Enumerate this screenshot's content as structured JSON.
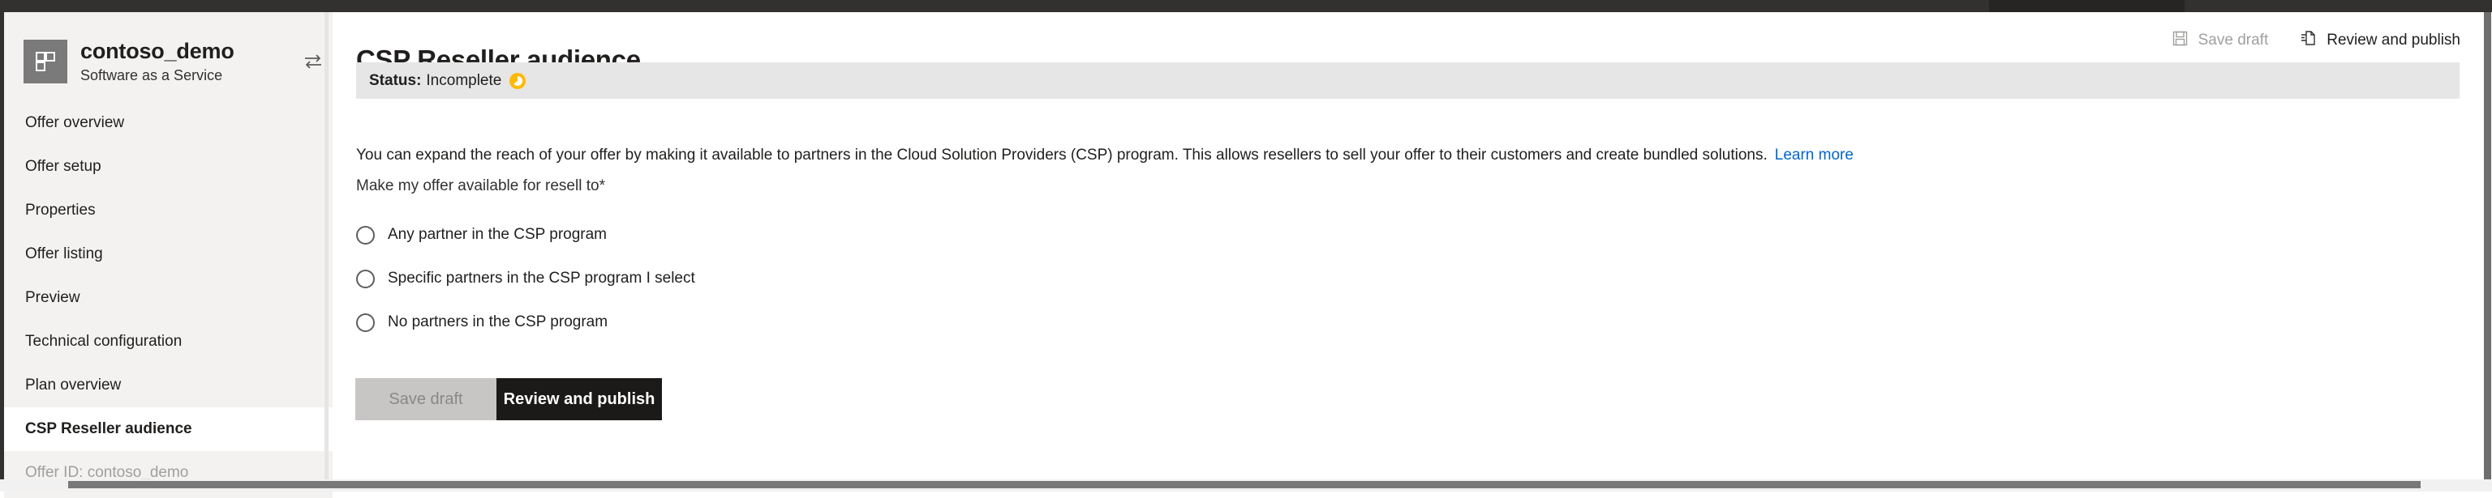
{
  "window": {
    "chrome_bar_color": "#323130",
    "active_tab_color": "#262523"
  },
  "sidebar": {
    "offer_name": "contoso_demo",
    "offer_type": "Software as a Service",
    "app_icon": "offer-grid-icon",
    "swap_icon": "swap-offer-icon",
    "items": [
      {
        "label": "Offer overview",
        "selected": false
      },
      {
        "label": "Offer setup",
        "selected": false
      },
      {
        "label": "Properties",
        "selected": false
      },
      {
        "label": "Offer listing",
        "selected": false
      },
      {
        "label": "Preview",
        "selected": false
      },
      {
        "label": "Technical configuration",
        "selected": false
      },
      {
        "label": "Plan overview",
        "selected": false
      },
      {
        "label": "CSP Reseller audience",
        "selected": true
      }
    ],
    "offer_id_footer": "Offer ID: contoso_demo"
  },
  "main": {
    "page_title": "CSP Reseller audience",
    "command_bar": {
      "save_draft": {
        "label": "Save draft",
        "icon": "save-disk-icon",
        "disabled": true
      },
      "review_and_publish": {
        "label": "Review and publish",
        "icon": "publish-page-icon",
        "disabled": false
      }
    },
    "status": {
      "label": "Status:",
      "value": "Incomplete",
      "icon": "clock-pending-icon",
      "icon_color": "#ffb900",
      "bar_color": "#e6e6e6"
    },
    "description": "You can expand the reach of your offer by making it available to partners in the Cloud Solution Providers (CSP) program. This allows resellers to sell your offer to their customers and create bundled solutions.",
    "learn_more_label": "Learn more",
    "learn_more_color": "#0066cc",
    "field_label": "Make my offer available for resell to",
    "required_marker": "*",
    "radio_options": [
      {
        "label": "Any partner in the CSP program",
        "selected": false
      },
      {
        "label": "Specific partners in the CSP program I select",
        "selected": false
      },
      {
        "label": "No partners in the CSP program",
        "selected": false
      }
    ],
    "footer_buttons": {
      "save_draft": {
        "label": "Save draft",
        "disabled": true
      },
      "review_and_publish": {
        "label": "Review and publish",
        "disabled": false
      }
    }
  }
}
